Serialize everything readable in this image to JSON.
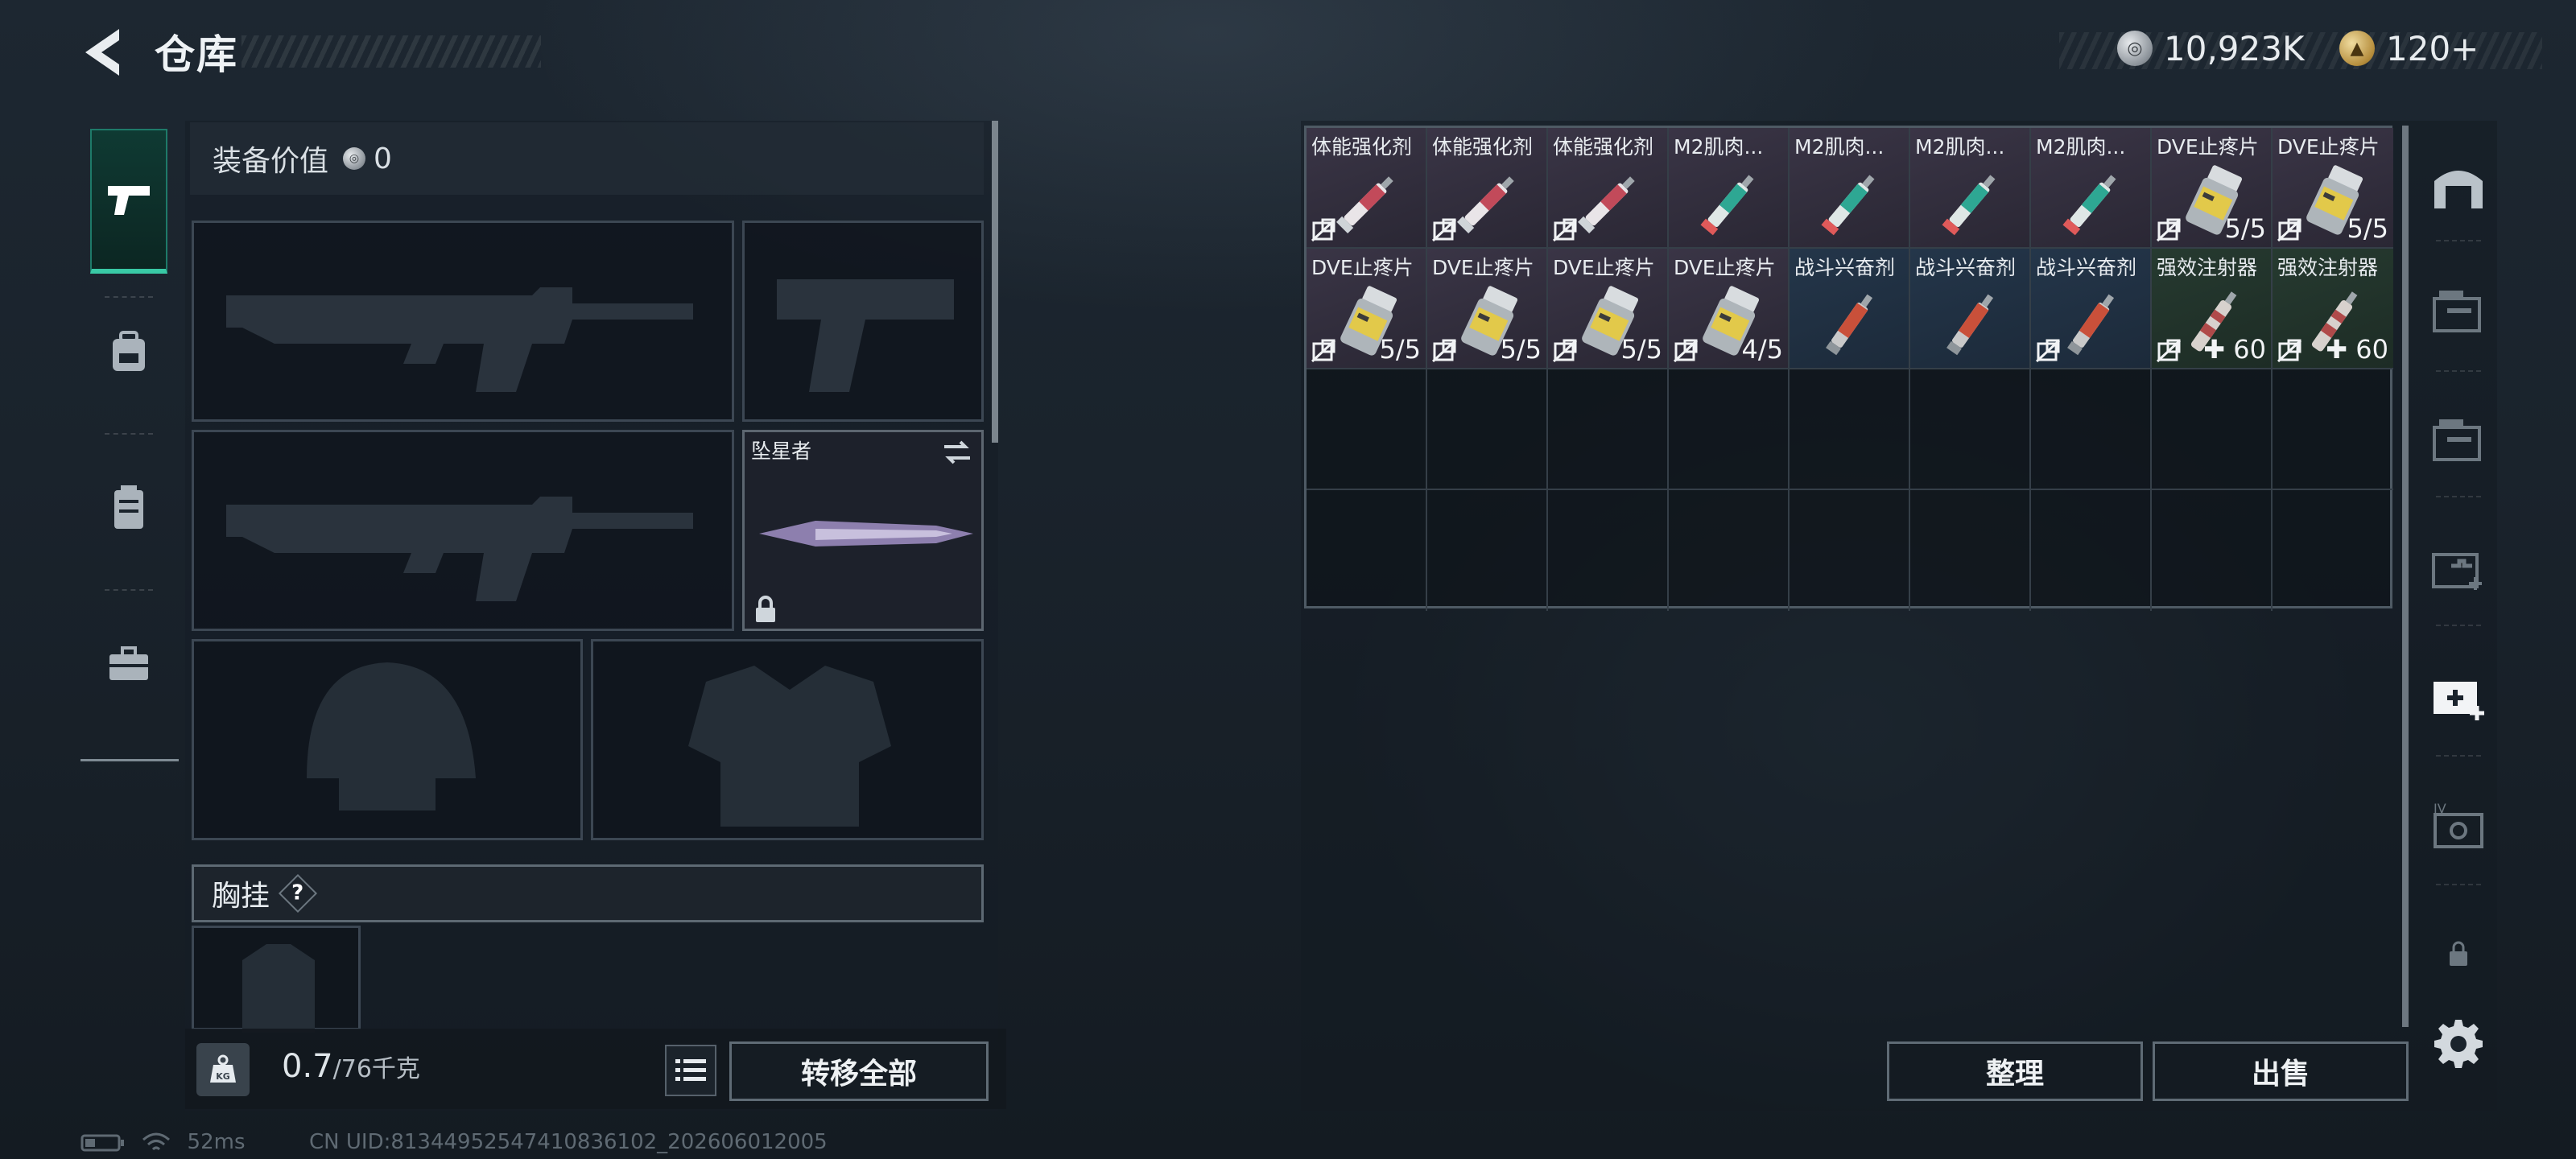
{
  "header": {
    "title": "仓库",
    "currency_silver": "10,923K",
    "currency_gold": "120+"
  },
  "equipment": {
    "value_label": "装备价值",
    "value": "0",
    "melee_name": "坠星者",
    "chest_label": "胸挂",
    "chest_help": "?"
  },
  "weight": {
    "current": "0.7",
    "max": "/76千克",
    "icon_label": "KG"
  },
  "actions": {
    "transfer_all": "转移全部",
    "organize": "整理",
    "sell": "出售"
  },
  "status": {
    "ping": "52ms",
    "uid": "CN UID:81344952547410836102_202606012005"
  },
  "inventory": {
    "items": [
      {
        "name": "体能强化剂",
        "count": "",
        "tone": "purple",
        "art": "syringe-red"
      },
      {
        "name": "体能强化剂",
        "count": "",
        "tone": "purple",
        "art": "syringe-red"
      },
      {
        "name": "体能强化剂",
        "count": "",
        "tone": "purple",
        "art": "syringe-red"
      },
      {
        "name": "M2肌肉...",
        "count": "",
        "tone": "purple",
        "art": "syringe-teal"
      },
      {
        "name": "M2肌肉...",
        "count": "",
        "tone": "purple",
        "art": "syringe-teal"
      },
      {
        "name": "M2肌肉...",
        "count": "",
        "tone": "purple",
        "art": "syringe-teal"
      },
      {
        "name": "M2肌肉...",
        "count": "",
        "tone": "purple",
        "art": "syringe-teal"
      },
      {
        "name": "DVE止疼片",
        "count": "5/5",
        "tone": "purple",
        "art": "pill-bottle"
      },
      {
        "name": "DVE止疼片",
        "count": "5/5",
        "tone": "purple",
        "art": "pill-bottle"
      },
      {
        "name": "DVE止疼片",
        "count": "5/5",
        "tone": "purple",
        "art": "pill-bottle"
      },
      {
        "name": "DVE止疼片",
        "count": "5/5",
        "tone": "purple",
        "art": "pill-bottle"
      },
      {
        "name": "DVE止疼片",
        "count": "5/5",
        "tone": "purple",
        "art": "pill-bottle"
      },
      {
        "name": "DVE止疼片",
        "count": "4/5",
        "tone": "purple",
        "art": "pill-bottle"
      },
      {
        "name": "战斗兴奋剂",
        "count": "",
        "tone": "blue",
        "art": "syringe-orange"
      },
      {
        "name": "战斗兴奋剂",
        "count": "",
        "tone": "blue",
        "art": "syringe-orange"
      },
      {
        "name": "战斗兴奋剂",
        "count": "",
        "tone": "blue",
        "art": "syringe-orange"
      },
      {
        "name": "强效注射器",
        "count": "✚ 60",
        "tone": "green",
        "art": "injector"
      },
      {
        "name": "强效注射器",
        "count": "✚ 60",
        "tone": "green",
        "art": "injector"
      }
    ],
    "locked_flags": [
      true,
      true,
      true,
      false,
      false,
      false,
      false,
      true,
      true,
      true,
      true,
      true,
      true,
      false,
      false,
      true,
      true,
      true
    ]
  }
}
